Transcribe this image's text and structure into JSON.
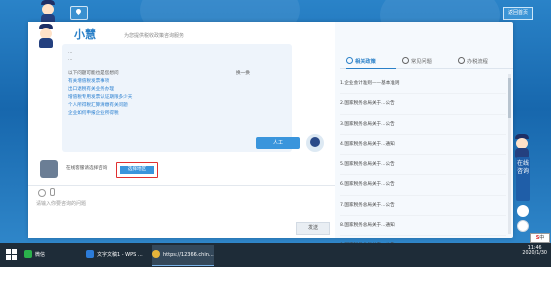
{
  "app": {
    "brand": "小慧",
    "subtitle": "为您提供税收政策咨询服务",
    "top_right_button": "返回首页"
  },
  "chat": {
    "bot_lines": [
      "...",
      "..."
    ],
    "intro_text": "以下问题可能也是您想问",
    "refresh_label": "换一换",
    "suggestions": [
      "有关增值税发票事项",
      "出口退税有关业务办理",
      "增值税专用发票认证期限多少天",
      "个人所得税汇算清缴有关问题",
      "企业如何申报企业所得税"
    ],
    "user_message": "人工",
    "bot_reply_prefix": "在线客服请选择咨询",
    "pick_button": "选择地区",
    "input_placeholder": "请输入你要咨询的问题",
    "send_label": "发送"
  },
  "right_panel": {
    "tabs": [
      {
        "label": "相关政策",
        "active": true
      },
      {
        "label": "常见问题",
        "active": false
      },
      {
        "label": "办税流程",
        "active": false
      }
    ],
    "items": [
      "1.企业会计准则——基本准则",
      "2.国家税务总局关于...公告",
      "3.国家税务总局关于...公告",
      "4.国家税务总局关于...通知",
      "5.国家税务总局关于...公告",
      "6.国家税务总局关于...公告",
      "7.国家税务总局关于...公告",
      "8.国家税务总局关于...通知",
      "9.国家税务总局关于...公告"
    ]
  },
  "side": {
    "online_label": "在线咨询"
  },
  "taskbar": {
    "items": [
      {
        "label": "微信",
        "color": "#2ab14b"
      },
      {
        "label": "文字文稿1 - WPS ...",
        "color": "#2c7cd9"
      },
      {
        "label": "https://12366.chin...",
        "color": "#e6b43a"
      }
    ],
    "time": "11:46",
    "date": "2020/1/30",
    "tray_lang": "中"
  }
}
